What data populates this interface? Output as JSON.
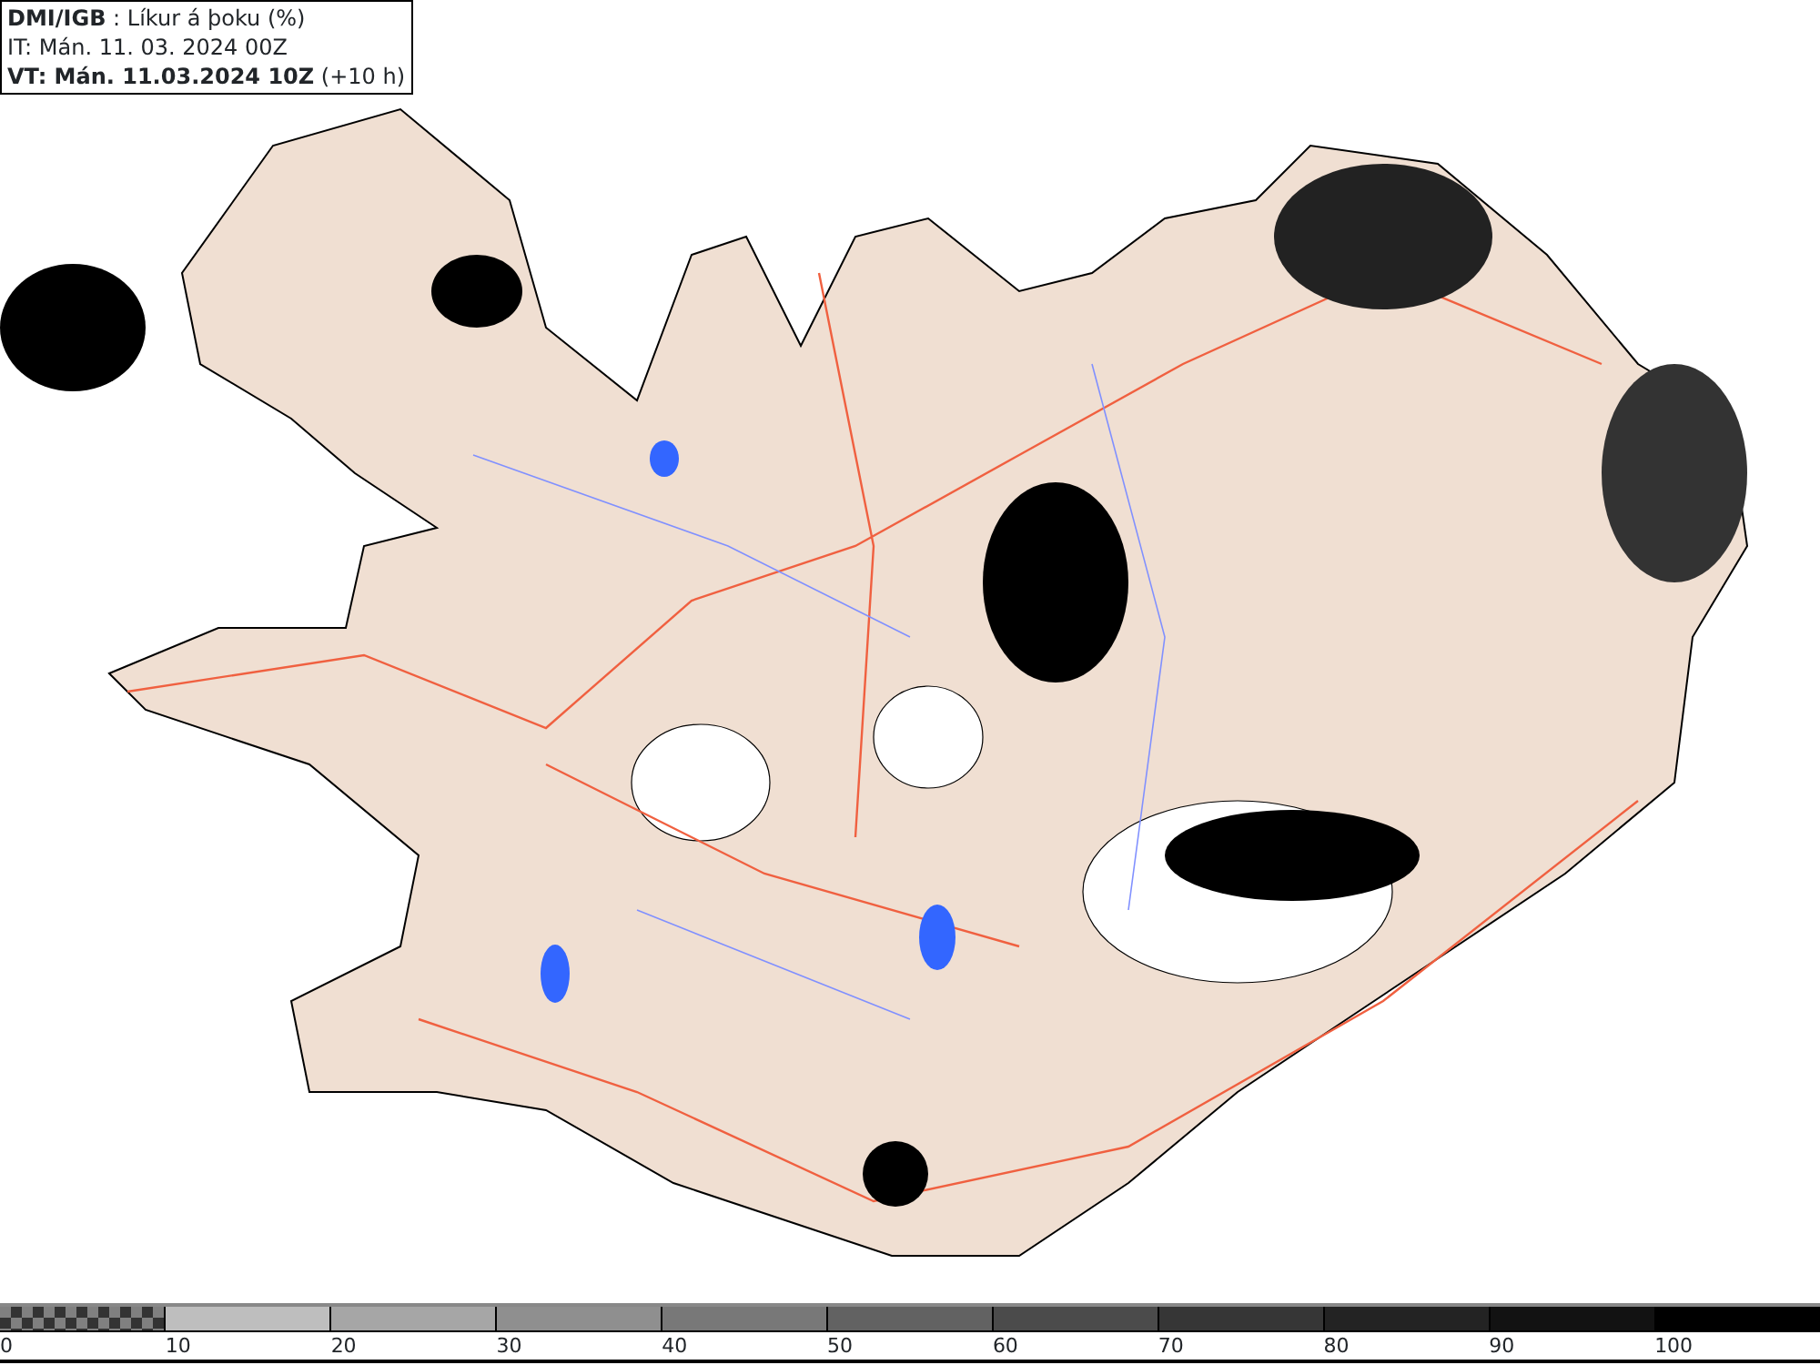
{
  "header": {
    "title": "**DMI/IGB** : Líkur á þoku (%)",
    "init_time": "IT: Mán. 11. 03. 2024 00Z",
    "valid_time": "**VT: Mán. 11.03.2024 10Z** (+10 h)"
  },
  "legend": [
    {
      "kind": "transparent",
      "label": "0"
    },
    {
      "kind": "fill",
      "color": "#bebebe",
      "label": "10"
    },
    {
      "kind": "fill",
      "color": "#a6a6a6",
      "label": "20"
    },
    {
      "kind": "fill",
      "color": "#8f8f8f",
      "label": "30"
    },
    {
      "kind": "fill",
      "color": "#787878",
      "label": "40"
    },
    {
      "kind": "fill",
      "color": "#626262",
      "label": "50"
    },
    {
      "kind": "fill",
      "color": "#4b4b4b",
      "label": "60"
    },
    {
      "kind": "fill",
      "color": "#363636",
      "label": "70"
    },
    {
      "kind": "fill",
      "color": "#232323",
      "label": "80"
    },
    {
      "kind": "fill",
      "color": "#121212",
      "label": "90"
    },
    {
      "kind": "fill",
      "color": "#000000",
      "label": "100"
    }
  ]
}
